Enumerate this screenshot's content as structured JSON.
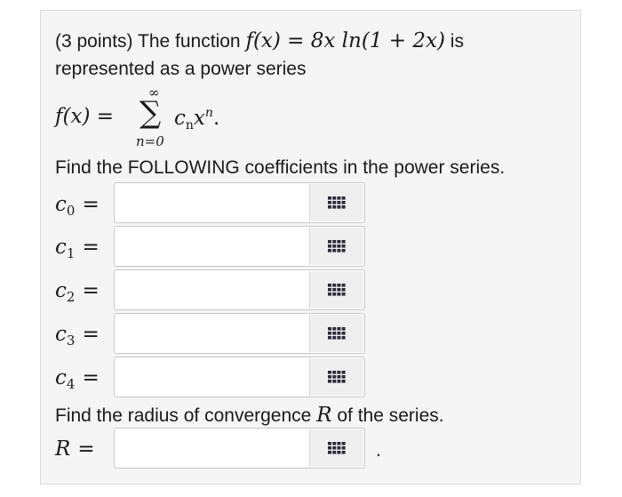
{
  "problem": {
    "points": "(3 points)",
    "intro_word": "The function",
    "function_expr": "f(x) = 8x ln(1 + 2x)",
    "intro_end": "is",
    "line2": "represented as a power series",
    "series": {
      "lhs": "f(x) =",
      "sigma": "∑",
      "upper": "∞",
      "lower": "n=0",
      "term": "c",
      "term_sub": "n",
      "term_var": "x",
      "term_sup": "n",
      "end": "."
    },
    "instruction": "Find the FOLLOWING coefficients in the power series.",
    "radius_instruction_pre": "Find the radius of convergence",
    "radius_symbol": "R",
    "radius_instruction_post": "of the series."
  },
  "answers": [
    {
      "var": "c",
      "sub": "0",
      "eq": "=",
      "value": "",
      "placeholder": ""
    },
    {
      "var": "c",
      "sub": "1",
      "eq": "=",
      "value": "",
      "placeholder": ""
    },
    {
      "var": "c",
      "sub": "2",
      "eq": "=",
      "value": "",
      "placeholder": ""
    },
    {
      "var": "c",
      "sub": "3",
      "eq": "=",
      "value": "",
      "placeholder": ""
    },
    {
      "var": "c",
      "sub": "4",
      "eq": "=",
      "value": "",
      "placeholder": ""
    }
  ],
  "radius_answer": {
    "var": "R",
    "eq": "=",
    "value": "",
    "placeholder": "",
    "trailing": "."
  },
  "icons": {
    "keypad": "keypad-grid-icon"
  },
  "colors": {
    "card_bg": "#f5f5f5",
    "card_border": "#dcdcdc",
    "field_border": "#c8c8c8",
    "keypad_bg": "#efefef",
    "keypad_icon": "#2a2a3a",
    "text": "#1a1a1a"
  }
}
